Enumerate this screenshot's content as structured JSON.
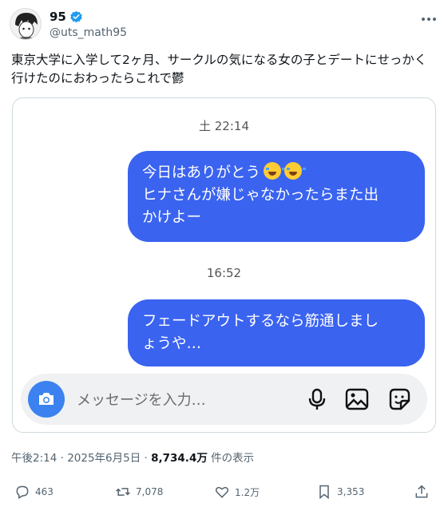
{
  "author": {
    "name": "95",
    "handle": "@uts_math95"
  },
  "tweet": {
    "text": "東京大学に入学して2ヶ月、サークルの気になる女の子とデートにせっかく行けたのにおわったらこれで鬱"
  },
  "chat": {
    "time1": "土 22:14",
    "msg1_line1": "今日はありがとう",
    "msg1_line2": "ヒナさんが嫌じゃなかったらまた出",
    "msg1_line3": "かけよー",
    "time2": "16:52",
    "msg2_line1": "フェードアウトするなら筋通しまし",
    "msg2_line2": "ょうや…",
    "placeholder": "メッセージを入力…"
  },
  "meta": {
    "datetime": "午後2:14 · 2025年6月5日 · ",
    "views": "8,734.4万",
    "views_label": " 件の表示"
  },
  "actions": {
    "replies": "463",
    "reposts": "7,078",
    "likes": "1.2万",
    "bookmarks": "3,353"
  },
  "colors": {
    "bubble": "#3a63f0",
    "camera": "#3b82f0",
    "verified": "#1d9bf0"
  },
  "icons": [
    "verified-badge-icon",
    "more-icon",
    "camera-icon",
    "microphone-icon",
    "gallery-icon",
    "sticker-icon",
    "reply-icon",
    "repost-icon",
    "like-icon",
    "bookmark-icon",
    "share-icon",
    "sob-emoji"
  ]
}
